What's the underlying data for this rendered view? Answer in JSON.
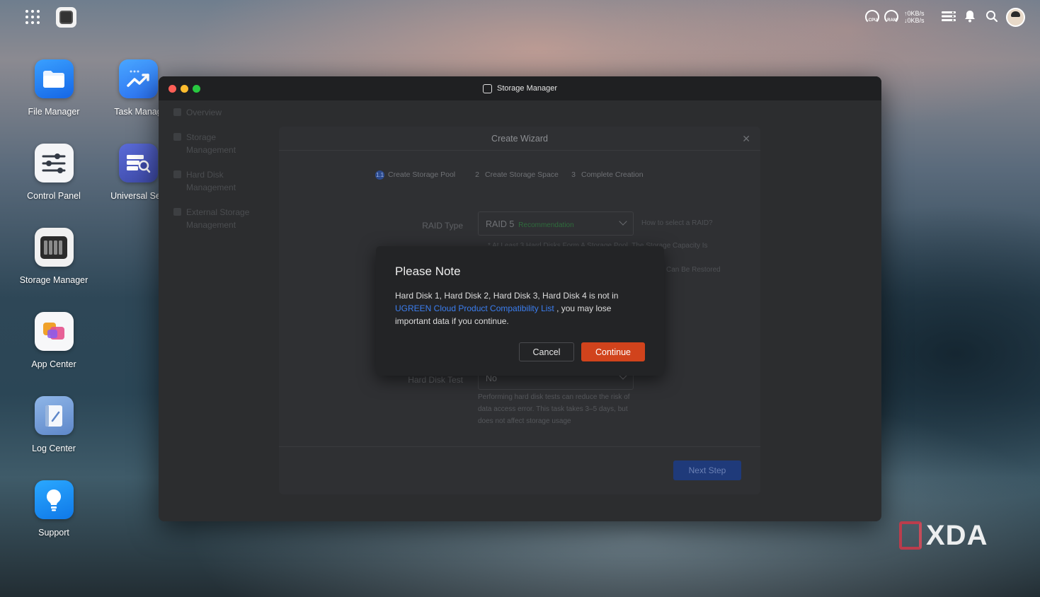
{
  "topbar": {
    "cpu_label": "CPU",
    "ram_label": "RAM",
    "upload_speed": "↑0KB/s",
    "download_speed": "↓0KB/s"
  },
  "desktop": {
    "icons": [
      {
        "label": "File Manager"
      },
      {
        "label": "Task Manag"
      },
      {
        "label": "Control Panel"
      },
      {
        "label": "Universal Sea"
      },
      {
        "label": "Storage Manager"
      },
      {
        "label": "App Center"
      },
      {
        "label": "Log Center"
      },
      {
        "label": "Support"
      }
    ]
  },
  "window": {
    "title": "Storage Manager",
    "sidebar": [
      {
        "label": "Overview"
      },
      {
        "label": "Storage Management"
      },
      {
        "label": "Hard Disk Management"
      },
      {
        "label": "External Storage Management"
      }
    ]
  },
  "wizard": {
    "title": "Create Wizard",
    "steps": [
      {
        "num": "1.1",
        "label": "Create Storage Pool"
      },
      {
        "num": "2",
        "label": "Create Storage Space"
      },
      {
        "num": "3",
        "label": "Complete Creation"
      }
    ],
    "raid_label": "RAID Type",
    "raid_value": "RAID 5",
    "raid_badge": "Recommendation",
    "raid_help_link": "How to select a RAID?",
    "raid_note_1": "* At Least 3 Hard Disks Form A Storage Pool. The Storage Capacity Is",
    "raid_note_2": "Can Be Restored",
    "disk_test_label": "Hard Disk Test",
    "disk_test_value": "No",
    "disk_test_help": "Performing hard disk tests can reduce the risk of data access error. This task takes 3–5 days, but does not affect storage usage",
    "next_label": "Next Step"
  },
  "modal": {
    "title": "Please Note",
    "body_prefix": "Hard Disk 1, Hard Disk 2, Hard Disk 3, Hard Disk 4 is not in",
    "body_link": "UGREEN Cloud Product Compatibility List",
    "body_suffix": ", you may lose important data if you continue.",
    "cancel_label": "Cancel",
    "continue_label": "Continue"
  },
  "watermark": {
    "text": "XDA"
  },
  "colors": {
    "accent_blue": "#3b7ef0",
    "danger": "#d1431c",
    "recommend_green": "#2f6b3c"
  }
}
